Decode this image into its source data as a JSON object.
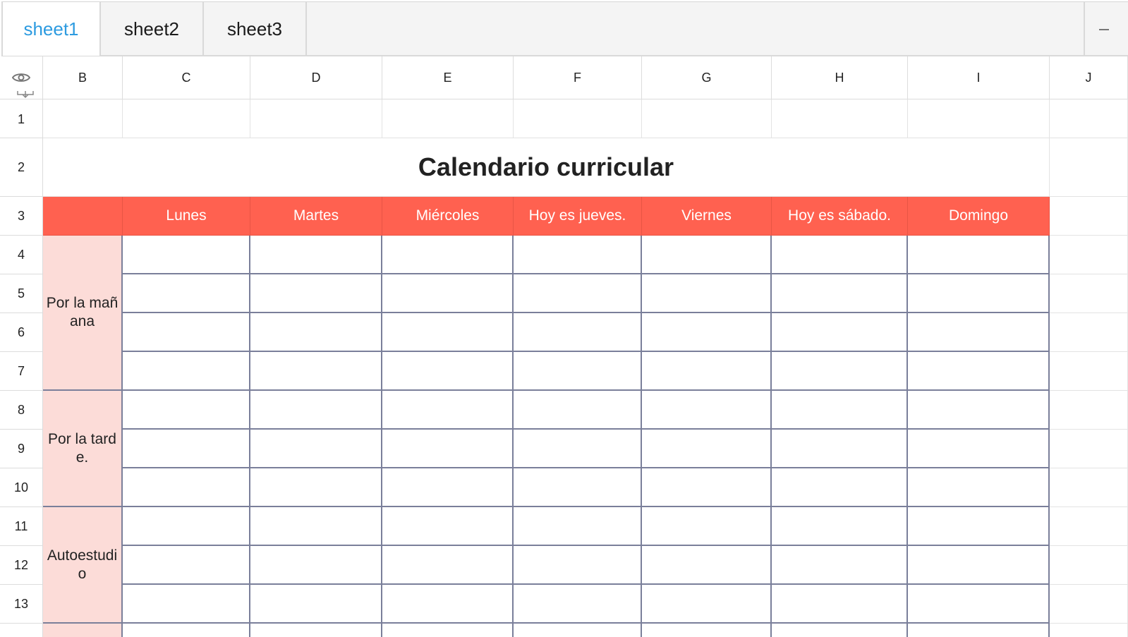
{
  "tabs": [
    {
      "label": "sheet1",
      "active": true
    },
    {
      "label": "sheet2",
      "active": false
    },
    {
      "label": "sheet3",
      "active": false
    }
  ],
  "columns": [
    "B",
    "C",
    "D",
    "E",
    "F",
    "G",
    "H",
    "I",
    "J"
  ],
  "rows": [
    "1",
    "2",
    "3",
    "4",
    "5",
    "6",
    "7",
    "8",
    "9",
    "10",
    "11",
    "12",
    "13"
  ],
  "sheet": {
    "title": "Calendario curricular",
    "days": [
      "Lunes",
      "Martes",
      "Miércoles",
      "Hoy es jueves.",
      "Viernes",
      "Hoy es sábado.",
      "Domingo"
    ],
    "bands": [
      "Por la mañana",
      "Por la tarde.",
      "Autoestudio"
    ]
  },
  "colors": {
    "header_red": "#ff6150",
    "band_pink": "#fcdcd8",
    "active_tab": "#2d9be0",
    "table_border": "#7a7f9a"
  },
  "icons": [
    "eye-icon",
    "freeze-rows-icon",
    "minus-icon"
  ]
}
